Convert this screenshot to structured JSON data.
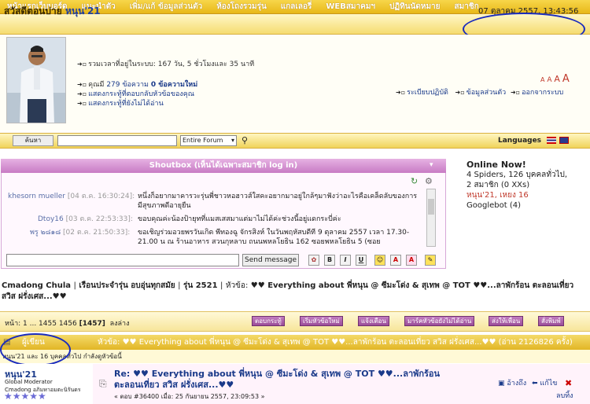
{
  "nav": [
    "หน้าแรกเว็บบอร์ด",
    "แนะนำตัว",
    "เพิ่ม/แก้ ข้อมูลส่วนตัว",
    "ห้องโถงรวมรุ่น",
    "แกลเลอรี่",
    "WEBสมาคมฯ",
    "ปฏิทินนัดหมาย",
    "สมาชิก"
  ],
  "greeting": {
    "prefix": "สวัสดีตอนบ่าย",
    "name": "หนุน'21"
  },
  "datetime": "07 ตุลาคม 2557, 13:43:56",
  "profile": {
    "total_time": "รวมเวลาที่อยู่ในระบบ: 167 วัน, 5 ชั่วโมงและ 35 นาที",
    "posts_prefix": "คุณมี",
    "posts_link": "279 ข้อความ",
    "posts_new": "0 ข้อความใหม่",
    "replies_link": "แสดงกระทู้ที่ตอบกลับหัวข้อของคุณ",
    "unread_link": "แสดงกระทู้ที่ยังไม่ได้อ่าน",
    "links": [
      "ระเบียบปฏิบัติ",
      "ข้อมูลส่วนตัว",
      "ออกจากระบบ"
    ],
    "font_sizes": [
      "A",
      "A",
      "A",
      "A"
    ]
  },
  "search": {
    "button": "ค้นหา",
    "scope": "Entire Forum",
    "languages": "Languages"
  },
  "shoutbox": {
    "title": "Shoutbox (เห็นได้เฉพาะสมาชิก log in)",
    "messages": [
      {
        "who": "khesorn mueller",
        "when": "[04 ต.ค. 16:30:24]:",
        "text": "หนึ่งก็อยากมาคารวะรุ่นพี่ชาวหอฮาวส์ใสคะอยากมาอยู่ใกล้ๆมาฟังว่าอะไรคือเคล็ดลับของการมีสุขภาพดีอายุยืน"
      },
      {
        "who": "Dtoy16",
        "when": "[03 ต.ค. 22:53:33]:",
        "text": "ขอบคุณค่ะน้องป้ายุทที่แมสเสสมาแต่มาไม่ได้ค่ะช่วงนี้อยู่แดกระบี่ค่ะ"
      },
      {
        "who": "พรู ๒๘๑๘",
        "when": "[02 ต.ค. 21:50:33]:",
        "text": "ขอเชิญร่วมอวยพรวันเกิด พี่ทองฉู จักรสิงห์ ในวันพฤหัสบดีที่ 9 ตุลาคม 2557 เวลา 17.30-21.00 น ณ ร้านอาหาร สวนกุหลาบ ถนนพหลโยธิน 162 ซอยพหลโยธิน 5 (ซอย"
      }
    ],
    "send": "Send message",
    "buttons": [
      "B",
      "I",
      "U",
      "☺",
      "A",
      "A"
    ]
  },
  "online": {
    "title": "Online Now!",
    "line1": "4 Spiders, 126 บุคคลทั่วไป,",
    "line2": "2 สมาชิก (0 XXs)",
    "members": "หนุน'21, เหยง 16",
    "bot": "Googlebot (4)"
  },
  "breadcrumb": {
    "board": "Cmadong Chula",
    "sep1": "|",
    "sub": "เรือนประจำรุ่น อบอุ่นทุกสมัย",
    "sep2": "|",
    "gen": "รุ่น 2521",
    "sep3": "|",
    "prefix": "หัวข้อ:",
    "topic": "♥♥ Everything about พี่หนุน @ ซีมะโด่ง & สุเทพ @ TOT ♥♥...ลาพักร้อน ตะลอนเที่ยว สวิส ฝรั่งเศส...♥♥"
  },
  "pages": {
    "prefix": "หน้า: 1 ... 1455 1456",
    "current": "[1457]",
    "down": "ลงล่าง"
  },
  "page_buttons": [
    "ตอบกระทู้",
    "เริ่มหัวข้อใหม่",
    "แจ้งเตือน",
    "มาร์คหัวข้อยังไม่ได้อ่าน",
    "ส่งให้เพื่อน",
    "สั่งพิมพ์"
  ],
  "thread": {
    "author_col": "ผู้เขียน",
    "title": "หัวข้อ: ♥♥ Everything about พี่หนุน @ ซีมะโด่ง & สุเทพ @ TOT ♥♥...ลาพักร้อน ตะลอนเที่ยว สวิส ฝรั่งเศส...♥♥  (อ่าน 2126826 ครั้ง)",
    "viewers": "หนุน'21 และ 16 บุคคลทั่วไป กำลังดูหัวข้อนี้"
  },
  "post": {
    "author": "หนุน'21",
    "role": "Global Moderator",
    "group": "Cmadong อภิมหาอมตะนิรันดร",
    "title": "Re: ♥♥ Everything about พี่หนุน @ ซีมะโด่ง & สุเทพ @ TOT ♥♥...ลาพักร้อน ตะลอนเที่ยว สวิส ฝรั่งเศส...♥♥",
    "meta": "« ตอบ #36400 เมื่อ: 25 กันยายน 2557, 23:09:53 »",
    "actions": [
      "อ้างถึง",
      "แก้ไข",
      "ลบทิ้ง"
    ]
  },
  "colors": {
    "gold": "#e8b819",
    "purple": "#c87bc4",
    "link": "#1a3a8a",
    "highlight": "#1a2bbd"
  }
}
